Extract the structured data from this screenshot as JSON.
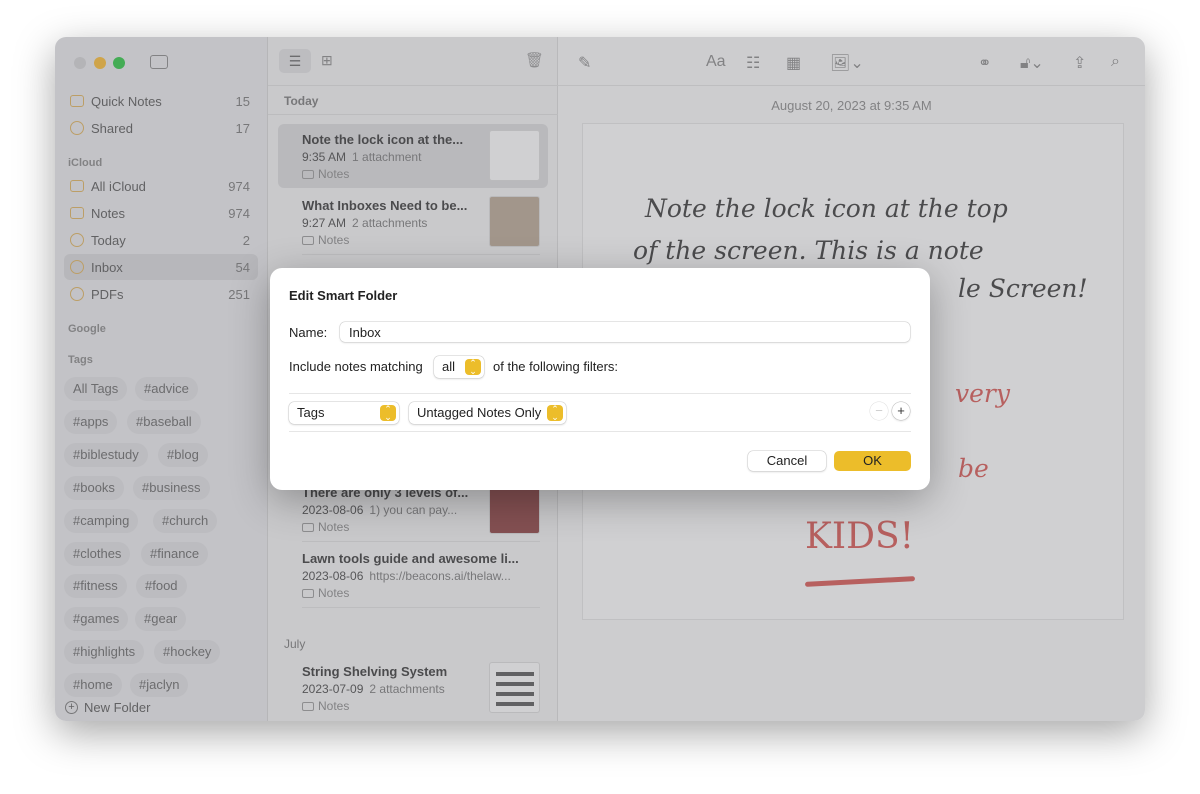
{
  "sidebar": {
    "items": [
      {
        "label": "Quick Notes",
        "count": "15"
      },
      {
        "label": "Shared",
        "count": "17"
      }
    ],
    "icloud_header": "iCloud",
    "icloud": [
      {
        "label": "All iCloud",
        "count": "974"
      },
      {
        "label": "Notes",
        "count": "974"
      },
      {
        "label": "Today",
        "count": "2"
      },
      {
        "label": "Inbox",
        "count": "54",
        "selected": true
      },
      {
        "label": "PDFs",
        "count": "251"
      }
    ],
    "google_header": "Google",
    "tags_header": "Tags",
    "tags": [
      "All Tags",
      "#advice",
      "#apps",
      "#baseball",
      "#biblestudy",
      "#blog",
      "#books",
      "#business",
      "#camping",
      "#church",
      "#clothes",
      "#finance",
      "#fitness",
      "#food",
      "#games",
      "#gear",
      "#highlights",
      "#hockey",
      "#home",
      "#jaclyn"
    ],
    "new_folder": "New Folder"
  },
  "list": {
    "today_header": "Today",
    "july_header": "July",
    "notes": [
      {
        "title": "Note the lock icon at the...",
        "time": "9:35 AM",
        "detail": "1 attachment",
        "folder": "Notes"
      },
      {
        "title": "What Inboxes Need to be...",
        "time": "9:27 AM",
        "detail": "2 attachments",
        "folder": "Notes"
      },
      {
        "title": "There are only 3 levels of...",
        "time": "2023-08-06",
        "detail": "1) you can pay...",
        "folder": "Notes"
      },
      {
        "title": "Lawn tools guide and awesome li...",
        "time": "2023-08-06",
        "detail": "https://beacons.ai/thelaw...",
        "folder": "Notes"
      },
      {
        "title": "String Shelving System",
        "time": "2023-07-09",
        "detail": "2 attachments",
        "folder": "Notes"
      }
    ]
  },
  "editor": {
    "date": "August 20, 2023 at 9:35 AM",
    "handwriting": [
      "Note the lock icon at the top",
      "of the screen. This is a note",
      "le Screen!",
      "very",
      "be",
      "KIDS!"
    ]
  },
  "dialog": {
    "title": "Edit Smart Folder",
    "name_label": "Name:",
    "name_value": "Inbox",
    "include_prefix": "Include notes matching",
    "match_value": "all",
    "include_suffix": "of the following filters:",
    "filter_field": "Tags",
    "filter_value": "Untagged Notes Only",
    "cancel": "Cancel",
    "ok": "OK"
  },
  "colors": {
    "accent": "#ecbd2a",
    "handwriting_red": "#d9534f"
  }
}
